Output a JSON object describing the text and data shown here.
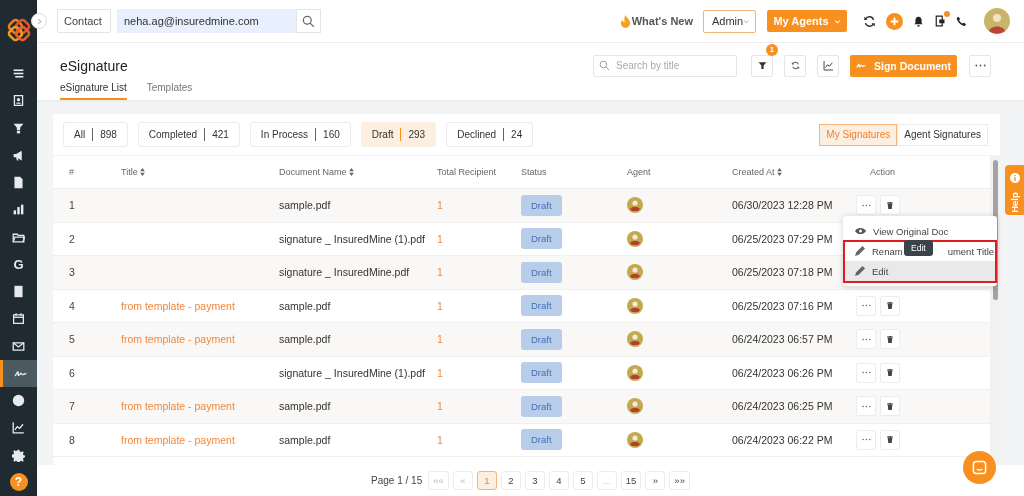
{
  "sidebar": {
    "items": [
      {
        "kind": "icon",
        "selected": false
      },
      {
        "kind": "icon",
        "selected": false
      },
      {
        "kind": "icon",
        "selected": false
      },
      {
        "kind": "icon",
        "selected": false
      },
      {
        "kind": "icon",
        "selected": false
      },
      {
        "kind": "icon",
        "selected": false
      },
      {
        "kind": "icon",
        "selected": false
      },
      {
        "kind": "glyph",
        "text": "G",
        "selected": false
      },
      {
        "kind": "icon",
        "selected": false
      },
      {
        "kind": "icon",
        "selected": false
      },
      {
        "kind": "icon",
        "selected": false
      },
      {
        "kind": "icon",
        "selected": true
      },
      {
        "kind": "icon",
        "selected": false
      },
      {
        "kind": "icon",
        "selected": false
      },
      {
        "kind": "icon",
        "selected": false
      },
      {
        "kind": "help",
        "text": "?",
        "selected": false
      }
    ]
  },
  "topbar": {
    "search_scope": "Contact",
    "search_value": "neha.ag@insuredmine.com",
    "whats_new": "What's New",
    "role": "Admin",
    "agents_button": "My Agents"
  },
  "page": {
    "title": "eSignature",
    "tabs": [
      {
        "label": "eSignature List",
        "selected": true
      },
      {
        "label": "Templates",
        "selected": false
      }
    ],
    "search": {
      "placeholder": "Search by title"
    },
    "filter_badge": "1",
    "primary_button": "Sign Document"
  },
  "status_filters": [
    {
      "label": "All",
      "count": "898",
      "selected": false
    },
    {
      "label": "Completed",
      "count": "421",
      "selected": false
    },
    {
      "label": "In Process",
      "count": "160",
      "selected": false
    },
    {
      "label": "Draft",
      "count": "293",
      "selected": true
    },
    {
      "label": "Declined",
      "count": "24",
      "selected": false
    }
  ],
  "signature_scope": [
    {
      "label": "My Signatures",
      "selected": true
    },
    {
      "label": "Agent Signatures",
      "selected": false
    }
  ],
  "table": {
    "columns": [
      {
        "label": "#",
        "sortable": false
      },
      {
        "label": "Title",
        "sortable": true
      },
      {
        "label": "Document Name",
        "sortable": true
      },
      {
        "label": "Total Recipient",
        "sortable": false
      },
      {
        "label": "Status",
        "sortable": false
      },
      {
        "label": "Agent",
        "sortable": false
      },
      {
        "label": "Created At",
        "sortable": true
      },
      {
        "label": "Action",
        "sortable": false
      }
    ],
    "rows": [
      {
        "number": "1",
        "document": "sample.pdf",
        "recipients": "1",
        "status": "Draft",
        "created_at": "06/30/2023 12:28 PM"
      },
      {
        "number": "2",
        "document": "signature _ InsuredMine (1).pdf",
        "recipients": "1",
        "status": "Draft",
        "created_at": "06/25/2023 07:29 PM"
      },
      {
        "number": "3",
        "document": "signature _ InsuredMine.pdf",
        "recipients": "1",
        "status": "Draft",
        "created_at": "06/25/2023 07:18 PM"
      },
      {
        "number": "4",
        "title": "from template - payment",
        "document": "sample.pdf",
        "recipients": "1",
        "status": "Draft",
        "created_at": "06/25/2023 07:16 PM"
      },
      {
        "number": "5",
        "title": "from template - payment",
        "document": "sample.pdf",
        "recipients": "1",
        "status": "Draft",
        "created_at": "06/24/2023 06:57 PM"
      },
      {
        "number": "6",
        "document": "signature _ InsuredMine (1).pdf",
        "recipients": "1",
        "status": "Draft",
        "created_at": "06/24/2023 06:26 PM"
      },
      {
        "number": "7",
        "title": "from template - payment",
        "document": "sample.pdf",
        "recipients": "1",
        "status": "Draft",
        "created_at": "06/24/2023 06:25 PM"
      },
      {
        "number": "8",
        "title": "from template - payment",
        "document": "sample.pdf",
        "recipients": "1",
        "status": "Draft",
        "created_at": "06/24/2023 06:22 PM"
      }
    ]
  },
  "action_menu": {
    "items": [
      {
        "label": "View Original Doc",
        "kind": "view",
        "highlighted": false
      },
      {
        "label": "Renam",
        "label_rest": "ument Title",
        "kind": "edit",
        "highlighted": false
      },
      {
        "label": "Edit",
        "kind": "edit",
        "highlighted": true
      }
    ],
    "tooltip": "Edit"
  },
  "pagination": {
    "label": "Page 1 / 15",
    "items": [
      {
        "label": "««",
        "selected": false,
        "disabled": true
      },
      {
        "label": "«",
        "selected": false,
        "disabled": true
      },
      {
        "label": "1",
        "selected": true,
        "disabled": false
      },
      {
        "label": "2",
        "selected": false,
        "disabled": false
      },
      {
        "label": "3",
        "selected": false,
        "disabled": false
      },
      {
        "label": "4",
        "selected": false,
        "disabled": false
      },
      {
        "label": "5",
        "selected": false,
        "disabled": false
      },
      {
        "label": "...",
        "selected": false,
        "disabled": true
      },
      {
        "label": "15",
        "selected": false,
        "disabled": false
      },
      {
        "label": "»",
        "selected": false,
        "disabled": false
      },
      {
        "label": "»»",
        "selected": false,
        "disabled": false
      }
    ]
  },
  "help_tab": "Help"
}
